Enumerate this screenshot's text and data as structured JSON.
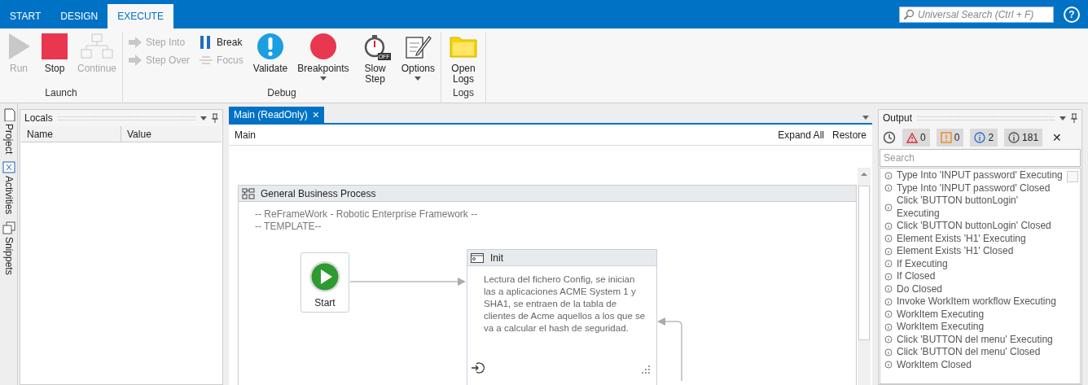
{
  "tabs": [
    {
      "label": "START",
      "selected": false
    },
    {
      "label": "DESIGN",
      "selected": false
    },
    {
      "label": "EXECUTE",
      "selected": true
    }
  ],
  "search": {
    "placeholder": "Universal Search (Ctrl + F)"
  },
  "help": "?",
  "ribbon_groups": [
    {
      "label": "Launch",
      "items": [
        {
          "kind": "large",
          "label": "Run",
          "disabled": true
        },
        {
          "kind": "large",
          "label": "Stop",
          "disabled": false
        },
        {
          "kind": "large",
          "label": "Continue",
          "disabled": true
        }
      ]
    },
    {
      "label": "Debug",
      "items": [
        {
          "kind": "small",
          "label": "Step Into",
          "disabled": true
        },
        {
          "kind": "small",
          "label": "Step Over",
          "disabled": true
        },
        {
          "kind": "small",
          "label": "Break",
          "disabled": false
        },
        {
          "kind": "small",
          "label": "Focus",
          "disabled": true
        },
        {
          "kind": "large",
          "label": "Validate",
          "disabled": false
        },
        {
          "kind": "large",
          "label": "Breakpoints",
          "disabled": false,
          "dropdown": true
        },
        {
          "kind": "large",
          "label": "Slow Step",
          "disabled": false,
          "badge": "OFF"
        },
        {
          "kind": "large",
          "label": "Options",
          "disabled": false,
          "dropdown": true
        }
      ]
    },
    {
      "label": "Logs",
      "items": [
        {
          "kind": "large",
          "label": "Open Logs",
          "disabled": false
        }
      ]
    }
  ],
  "side_tabs": [
    {
      "label": "Project"
    },
    {
      "label": "Activities"
    },
    {
      "label": "Snippets"
    }
  ],
  "locals": {
    "title": "Locals",
    "columns": [
      "Name",
      "Value"
    ]
  },
  "document": {
    "tab": "Main (ReadOnly)",
    "close": "×",
    "breadcrumb": "Main",
    "actions": [
      "Expand All",
      "Restore"
    ],
    "sequence": {
      "title": "General Business Process",
      "comment": [
        "-- ReFrameWork - Robotic Enterprise Framework --",
        "-- TEMPLATE--"
      ],
      "start": {
        "label": "Start"
      },
      "state": {
        "title": "Init",
        "description": "Lectura del fichero Config, se inician las a aplicaciones ACME System 1 y SHA1, se entraen de la tabla de clientes de Acme aquellos a los que se va a calcular el hash de seguridad."
      }
    }
  },
  "output": {
    "title": "Output",
    "filters": [
      {
        "kind": "error",
        "count": "0"
      },
      {
        "kind": "warning",
        "count": "0"
      },
      {
        "kind": "info",
        "count": "2"
      },
      {
        "kind": "trace",
        "count": "181"
      }
    ],
    "clear": "✕",
    "search_placeholder": "Search",
    "entries": [
      "Type Into 'INPUT  password' Executing",
      "Type Into 'INPUT  password' Closed",
      "Click 'BUTTON  buttonLogin' Executing",
      "Click 'BUTTON  buttonLogin' Closed",
      "Element Exists 'H1' Executing",
      "Element Exists 'H1' Closed",
      "If Executing",
      "If Closed",
      "Do Closed",
      "Invoke WorkItem workflow Executing",
      "WorkItem Executing",
      "WorkItem Executing",
      "Click 'BUTTON del menu' Executing",
      "Click 'BUTTON del menu' Closed",
      "WorkItem Closed"
    ]
  }
}
